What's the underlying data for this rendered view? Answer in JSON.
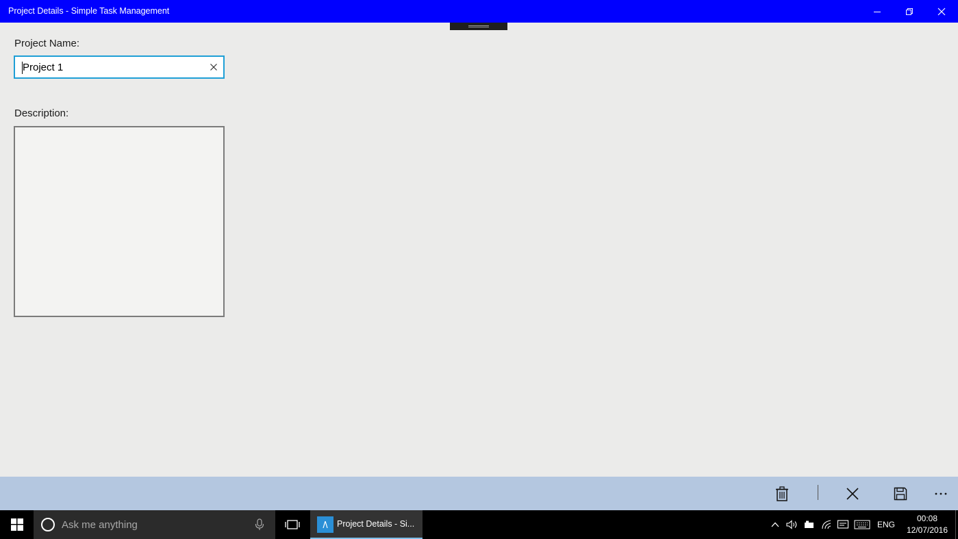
{
  "window": {
    "title": "Project Details - Simple Task Management",
    "titlebar_color": "#0000ff"
  },
  "form": {
    "project_name_label": "Project Name:",
    "project_name_value": "Project 1",
    "description_label": "Description:",
    "description_value": "",
    "focus_color": "#1e9fd6"
  },
  "command_bar": {
    "background": "#b4c7e0",
    "buttons": [
      {
        "icon": "delete-icon",
        "label": "Delete"
      },
      {
        "icon": "cancel-icon",
        "label": "Cancel"
      },
      {
        "icon": "save-icon",
        "label": "Save"
      },
      {
        "icon": "more-icon",
        "label": "More"
      }
    ]
  },
  "taskbar": {
    "search_placeholder": "Ask me anything",
    "active_app_label": "Project Details - Si...",
    "language": "ENG",
    "time": "00:08",
    "date": "12/07/2016"
  }
}
